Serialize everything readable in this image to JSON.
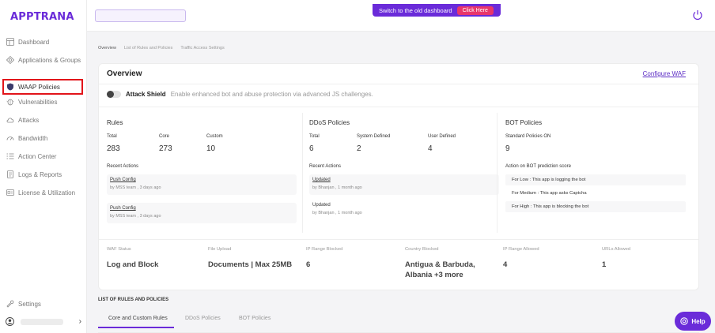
{
  "brand": {
    "logo_text": "APPTRANA",
    "accent": "#6a2bd9"
  },
  "sidebar": {
    "items": [
      {
        "label": "Dashboard",
        "icon": "dashboard-icon"
      },
      {
        "label": "Applications & Groups",
        "icon": "applications-icon"
      },
      {
        "label": "WAAP Policies",
        "icon": "shield-icon",
        "active": true
      },
      {
        "label": "Vulnerabilities",
        "icon": "bug-icon"
      },
      {
        "label": "Attacks",
        "icon": "cloud-icon"
      },
      {
        "label": "Bandwidth",
        "icon": "gauge-icon"
      },
      {
        "label": "Action Center",
        "icon": "list-icon"
      },
      {
        "label": "Logs & Reports",
        "icon": "report-icon"
      },
      {
        "label": "License & Utilization",
        "icon": "license-icon"
      }
    ],
    "settings_label": "Settings"
  },
  "header": {
    "banner_text": "Switch to the old dashboard",
    "banner_button": "Click Here"
  },
  "breadcrumb": [
    "Overview",
    "List of Rules and Policies",
    "Traffic Access Settings"
  ],
  "overview": {
    "title": "Overview",
    "configure_link": "Configure WAF",
    "attack_shield": {
      "name": "Attack Shield",
      "description": "Enable enhanced bot and abuse protection via advanced JS challenges."
    },
    "rules": {
      "title": "Rules",
      "stats": [
        {
          "label": "Total",
          "value": "283"
        },
        {
          "label": "Core",
          "value": "273"
        },
        {
          "label": "Custom",
          "value": "10"
        }
      ],
      "recent_label": "Recent Actions",
      "actions": [
        {
          "title": "Push Config",
          "sub": "by MSS team , 3 days ago"
        },
        {
          "title": "Push Config",
          "sub": "by MSS team , 3 days ago"
        }
      ]
    },
    "ddos": {
      "title": "DDoS Policies",
      "stats": [
        {
          "label": "Total",
          "value": "6"
        },
        {
          "label": "System Defined",
          "value": "2"
        },
        {
          "label": "User Defined",
          "value": "4"
        }
      ],
      "recent_label": "Recent Actions",
      "actions": [
        {
          "title": "Updated",
          "sub": "by Bhanjan , 1 month ago"
        },
        {
          "title": "Updated",
          "sub": "by Bhanjan , 1 month ago"
        }
      ]
    },
    "bot": {
      "title": "BOT Policies",
      "standard_label": "Standard Policies ON",
      "standard_value": "9",
      "score_label": "Action on BOT prediction score",
      "rows": [
        "For Low : This app is logging the bot",
        "For Medium : This app asks Captcha",
        "For High : This app is blocking the bot"
      ]
    },
    "bottom": [
      {
        "label": "WAF Status",
        "value": "Log and Block"
      },
      {
        "label": "File Upload",
        "value": "Documents | Max 25MB"
      },
      {
        "label": "IP Range Blocked",
        "value": "6"
      },
      {
        "label": "Country Blocked",
        "value": "Antigua & Barbuda, Albania +3 more"
      },
      {
        "label": "IP Range Allowed",
        "value": "4"
      },
      {
        "label": "URLs Allowed",
        "value": "1"
      }
    ]
  },
  "list": {
    "title": "LIST OF RULES AND POLICIES",
    "tabs": [
      "Core and Custom Rules",
      "DDoS Policies",
      "BOT Policies"
    ]
  },
  "help_label": "Help"
}
